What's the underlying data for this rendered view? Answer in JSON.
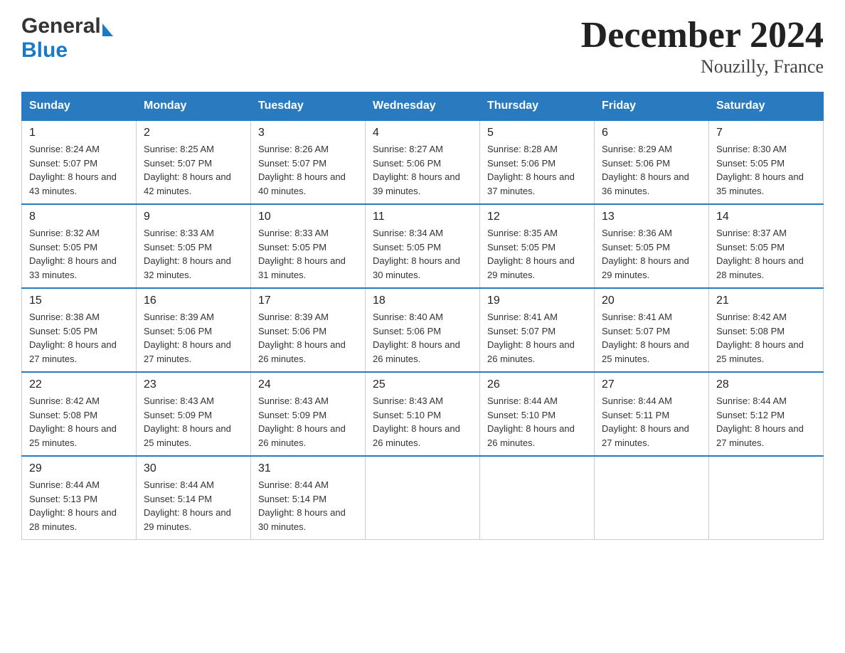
{
  "header": {
    "title": "December 2024",
    "subtitle": "Nouzilly, France",
    "logo_general": "General",
    "logo_blue": "Blue"
  },
  "days_of_week": [
    "Sunday",
    "Monday",
    "Tuesday",
    "Wednesday",
    "Thursday",
    "Friday",
    "Saturday"
  ],
  "weeks": [
    [
      {
        "day": "1",
        "sunrise": "Sunrise: 8:24 AM",
        "sunset": "Sunset: 5:07 PM",
        "daylight": "Daylight: 8 hours and 43 minutes."
      },
      {
        "day": "2",
        "sunrise": "Sunrise: 8:25 AM",
        "sunset": "Sunset: 5:07 PM",
        "daylight": "Daylight: 8 hours and 42 minutes."
      },
      {
        "day": "3",
        "sunrise": "Sunrise: 8:26 AM",
        "sunset": "Sunset: 5:07 PM",
        "daylight": "Daylight: 8 hours and 40 minutes."
      },
      {
        "day": "4",
        "sunrise": "Sunrise: 8:27 AM",
        "sunset": "Sunset: 5:06 PM",
        "daylight": "Daylight: 8 hours and 39 minutes."
      },
      {
        "day": "5",
        "sunrise": "Sunrise: 8:28 AM",
        "sunset": "Sunset: 5:06 PM",
        "daylight": "Daylight: 8 hours and 37 minutes."
      },
      {
        "day": "6",
        "sunrise": "Sunrise: 8:29 AM",
        "sunset": "Sunset: 5:06 PM",
        "daylight": "Daylight: 8 hours and 36 minutes."
      },
      {
        "day": "7",
        "sunrise": "Sunrise: 8:30 AM",
        "sunset": "Sunset: 5:05 PM",
        "daylight": "Daylight: 8 hours and 35 minutes."
      }
    ],
    [
      {
        "day": "8",
        "sunrise": "Sunrise: 8:32 AM",
        "sunset": "Sunset: 5:05 PM",
        "daylight": "Daylight: 8 hours and 33 minutes."
      },
      {
        "day": "9",
        "sunrise": "Sunrise: 8:33 AM",
        "sunset": "Sunset: 5:05 PM",
        "daylight": "Daylight: 8 hours and 32 minutes."
      },
      {
        "day": "10",
        "sunrise": "Sunrise: 8:33 AM",
        "sunset": "Sunset: 5:05 PM",
        "daylight": "Daylight: 8 hours and 31 minutes."
      },
      {
        "day": "11",
        "sunrise": "Sunrise: 8:34 AM",
        "sunset": "Sunset: 5:05 PM",
        "daylight": "Daylight: 8 hours and 30 minutes."
      },
      {
        "day": "12",
        "sunrise": "Sunrise: 8:35 AM",
        "sunset": "Sunset: 5:05 PM",
        "daylight": "Daylight: 8 hours and 29 minutes."
      },
      {
        "day": "13",
        "sunrise": "Sunrise: 8:36 AM",
        "sunset": "Sunset: 5:05 PM",
        "daylight": "Daylight: 8 hours and 29 minutes."
      },
      {
        "day": "14",
        "sunrise": "Sunrise: 8:37 AM",
        "sunset": "Sunset: 5:05 PM",
        "daylight": "Daylight: 8 hours and 28 minutes."
      }
    ],
    [
      {
        "day": "15",
        "sunrise": "Sunrise: 8:38 AM",
        "sunset": "Sunset: 5:05 PM",
        "daylight": "Daylight: 8 hours and 27 minutes."
      },
      {
        "day": "16",
        "sunrise": "Sunrise: 8:39 AM",
        "sunset": "Sunset: 5:06 PM",
        "daylight": "Daylight: 8 hours and 27 minutes."
      },
      {
        "day": "17",
        "sunrise": "Sunrise: 8:39 AM",
        "sunset": "Sunset: 5:06 PM",
        "daylight": "Daylight: 8 hours and 26 minutes."
      },
      {
        "day": "18",
        "sunrise": "Sunrise: 8:40 AM",
        "sunset": "Sunset: 5:06 PM",
        "daylight": "Daylight: 8 hours and 26 minutes."
      },
      {
        "day": "19",
        "sunrise": "Sunrise: 8:41 AM",
        "sunset": "Sunset: 5:07 PM",
        "daylight": "Daylight: 8 hours and 26 minutes."
      },
      {
        "day": "20",
        "sunrise": "Sunrise: 8:41 AM",
        "sunset": "Sunset: 5:07 PM",
        "daylight": "Daylight: 8 hours and 25 minutes."
      },
      {
        "day": "21",
        "sunrise": "Sunrise: 8:42 AM",
        "sunset": "Sunset: 5:08 PM",
        "daylight": "Daylight: 8 hours and 25 minutes."
      }
    ],
    [
      {
        "day": "22",
        "sunrise": "Sunrise: 8:42 AM",
        "sunset": "Sunset: 5:08 PM",
        "daylight": "Daylight: 8 hours and 25 minutes."
      },
      {
        "day": "23",
        "sunrise": "Sunrise: 8:43 AM",
        "sunset": "Sunset: 5:09 PM",
        "daylight": "Daylight: 8 hours and 25 minutes."
      },
      {
        "day": "24",
        "sunrise": "Sunrise: 8:43 AM",
        "sunset": "Sunset: 5:09 PM",
        "daylight": "Daylight: 8 hours and 26 minutes."
      },
      {
        "day": "25",
        "sunrise": "Sunrise: 8:43 AM",
        "sunset": "Sunset: 5:10 PM",
        "daylight": "Daylight: 8 hours and 26 minutes."
      },
      {
        "day": "26",
        "sunrise": "Sunrise: 8:44 AM",
        "sunset": "Sunset: 5:10 PM",
        "daylight": "Daylight: 8 hours and 26 minutes."
      },
      {
        "day": "27",
        "sunrise": "Sunrise: 8:44 AM",
        "sunset": "Sunset: 5:11 PM",
        "daylight": "Daylight: 8 hours and 27 minutes."
      },
      {
        "day": "28",
        "sunrise": "Sunrise: 8:44 AM",
        "sunset": "Sunset: 5:12 PM",
        "daylight": "Daylight: 8 hours and 27 minutes."
      }
    ],
    [
      {
        "day": "29",
        "sunrise": "Sunrise: 8:44 AM",
        "sunset": "Sunset: 5:13 PM",
        "daylight": "Daylight: 8 hours and 28 minutes."
      },
      {
        "day": "30",
        "sunrise": "Sunrise: 8:44 AM",
        "sunset": "Sunset: 5:14 PM",
        "daylight": "Daylight: 8 hours and 29 minutes."
      },
      {
        "day": "31",
        "sunrise": "Sunrise: 8:44 AM",
        "sunset": "Sunset: 5:14 PM",
        "daylight": "Daylight: 8 hours and 30 minutes."
      },
      null,
      null,
      null,
      null
    ]
  ]
}
